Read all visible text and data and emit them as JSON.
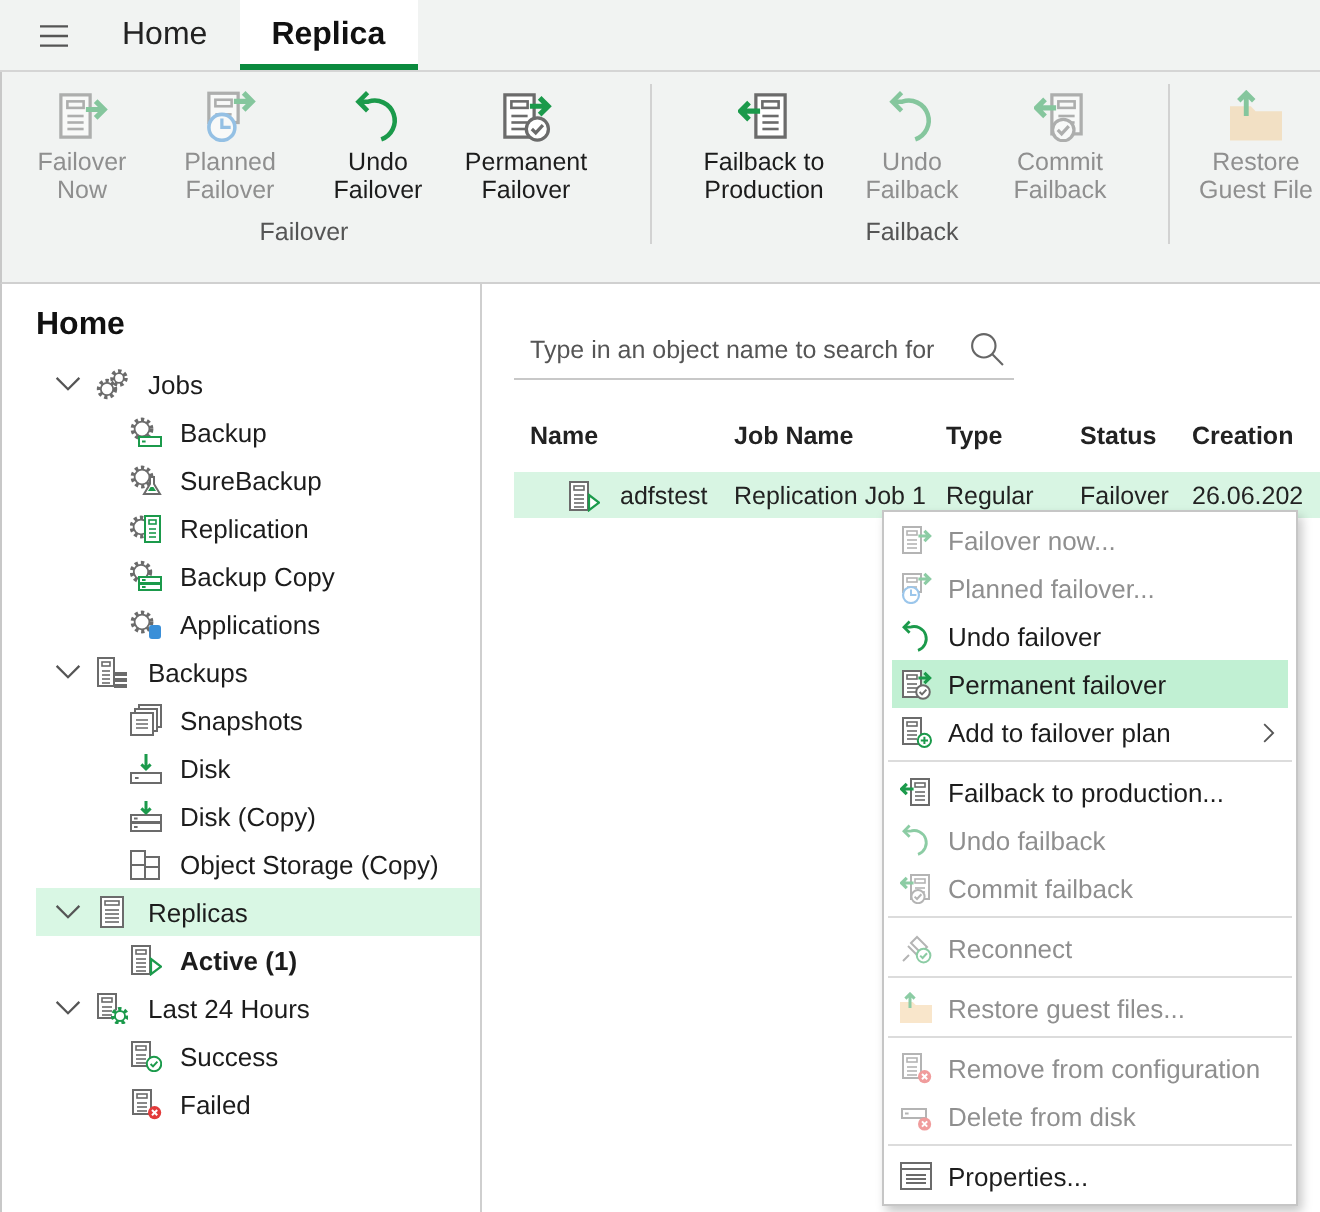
{
  "top_bar": {
    "tabs": [
      {
        "label": "Home",
        "selected": false
      },
      {
        "label": "Replica",
        "selected": true
      }
    ]
  },
  "ribbon": {
    "groups": [
      {
        "label": "Failover",
        "buttons": [
          {
            "label": "Failover Now",
            "disabled": true
          },
          {
            "label": "Planned Failover",
            "disabled": true
          },
          {
            "label": "Undo Failover",
            "disabled": false
          },
          {
            "label": "Permanent Failover",
            "disabled": false
          }
        ]
      },
      {
        "label": "Failback",
        "buttons": [
          {
            "label": "Failback to Production",
            "disabled": false
          },
          {
            "label": "Undo Failback",
            "disabled": true
          },
          {
            "label": "Commit Failback",
            "disabled": true
          }
        ]
      },
      {
        "buttons": [
          {
            "label": "Restore Guest File",
            "disabled": true
          }
        ]
      }
    ]
  },
  "sidebar": {
    "title": "Home",
    "tree": [
      {
        "label": "Jobs",
        "expanded": true,
        "selected": false,
        "bold": false,
        "children": [
          {
            "label": "Backup",
            "selected": false,
            "bold": false
          },
          {
            "label": "SureBackup",
            "selected": false,
            "bold": false
          },
          {
            "label": "Replication",
            "selected": false,
            "bold": false
          },
          {
            "label": "Backup Copy",
            "selected": false,
            "bold": false
          },
          {
            "label": "Applications",
            "selected": false,
            "bold": false
          }
        ]
      },
      {
        "label": "Backups",
        "expanded": true,
        "selected": false,
        "bold": false,
        "children": [
          {
            "label": "Snapshots",
            "selected": false,
            "bold": false
          },
          {
            "label": "Disk",
            "selected": false,
            "bold": false
          },
          {
            "label": "Disk (Copy)",
            "selected": false,
            "bold": false
          },
          {
            "label": "Object Storage (Copy)",
            "selected": false,
            "bold": false
          }
        ]
      },
      {
        "label": "Replicas",
        "expanded": true,
        "selected": true,
        "bold": false,
        "children": [
          {
            "label": "Active (1)",
            "selected": false,
            "bold": true
          }
        ]
      },
      {
        "label": "Last 24 Hours",
        "expanded": true,
        "selected": false,
        "bold": false,
        "children": [
          {
            "label": "Success",
            "selected": false,
            "bold": false
          },
          {
            "label": "Failed",
            "selected": false,
            "bold": false
          }
        ]
      }
    ]
  },
  "main": {
    "search": {
      "placeholder": "Type in an object name to search for"
    },
    "table": {
      "columns": [
        "Name",
        "Job Name",
        "Type",
        "Status",
        "Creation"
      ],
      "rows": [
        {
          "selected": true,
          "cells": [
            "adfstest",
            "Replication Job 1",
            "Regular",
            "Failover",
            "26.06.202"
          ]
        }
      ]
    }
  },
  "context_menu": {
    "groups": [
      [
        {
          "label": "Failover now...",
          "disabled": true,
          "highlighted": false,
          "has_submenu": false
        },
        {
          "label": "Planned failover...",
          "disabled": true,
          "highlighted": false,
          "has_submenu": false
        },
        {
          "label": "Undo failover",
          "disabled": false,
          "highlighted": false,
          "has_submenu": false
        },
        {
          "label": "Permanent failover",
          "disabled": false,
          "highlighted": true,
          "has_submenu": false
        },
        {
          "label": "Add to failover plan",
          "disabled": false,
          "highlighted": false,
          "has_submenu": true
        }
      ],
      [
        {
          "label": "Failback to production...",
          "disabled": false,
          "highlighted": false,
          "has_submenu": false
        },
        {
          "label": "Undo failback",
          "disabled": true,
          "highlighted": false,
          "has_submenu": false
        },
        {
          "label": "Commit failback",
          "disabled": true,
          "highlighted": false,
          "has_submenu": false
        }
      ],
      [
        {
          "label": "Reconnect",
          "disabled": true,
          "highlighted": false,
          "has_submenu": false
        }
      ],
      [
        {
          "label": "Restore guest files...",
          "disabled": true,
          "highlighted": false,
          "has_submenu": false
        }
      ],
      [
        {
          "label": "Remove from configuration",
          "disabled": true,
          "highlighted": false,
          "has_submenu": false
        },
        {
          "label": "Delete from disk",
          "disabled": true,
          "highlighted": false,
          "has_submenu": false
        }
      ],
      [
        {
          "label": "Properties...",
          "disabled": false,
          "highlighted": false,
          "has_submenu": false
        }
      ]
    ]
  }
}
